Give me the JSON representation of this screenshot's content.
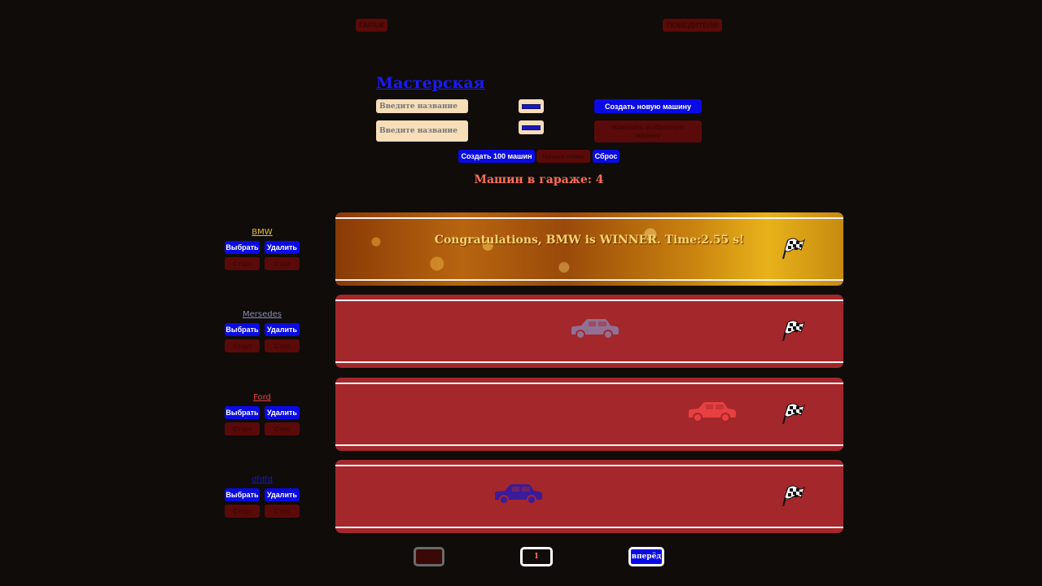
{
  "nav": {
    "garage_label": "ГАРАЖ",
    "winners_label": "ПОБЕДИТЕЛИ"
  },
  "workshop": {
    "title": "Мастерская",
    "create_placeholder": "Введите название",
    "update_placeholder": "Введите название",
    "create_button": "Создать новую машину",
    "update_button": "Изменить выбранную машину",
    "create_color": "#1a18c0",
    "update_color": "#1a18c0"
  },
  "controls": {
    "generate_label": "Создать 100 машин",
    "race_label": "Начать гонку",
    "reset_label": "Сброс"
  },
  "garage_count": "Машин в гараже: 4",
  "winner_message": "Congratulations, BMW is WINNER. Time:2.55 s!",
  "cars": [
    {
      "name": "BMW",
      "color": "#e8c12a",
      "select": "Выбрать",
      "remove": "Удалить",
      "start": "Старт",
      "stop": "Стоп",
      "position": 1.0
    },
    {
      "name": "Mersedes",
      "color": "#8a8ab8",
      "select": "Выбрать",
      "remove": "Удалить",
      "start": "Старт",
      "stop": "Стоп",
      "position": 0.62
    },
    {
      "name": "Ford",
      "color": "#e84040",
      "select": "Выбрать",
      "remove": "Удалить",
      "start": "Старт",
      "stop": "Стоп",
      "position": 0.88
    },
    {
      "name": "dfdfd",
      "color": "#1a18c0",
      "select": "Выбрать",
      "remove": "Удалить",
      "start": "Старт",
      "stop": "Стоп",
      "position": 0.45
    }
  ],
  "pagination": {
    "prev_label": "назад",
    "page": "1",
    "next_label": "вперёд"
  }
}
